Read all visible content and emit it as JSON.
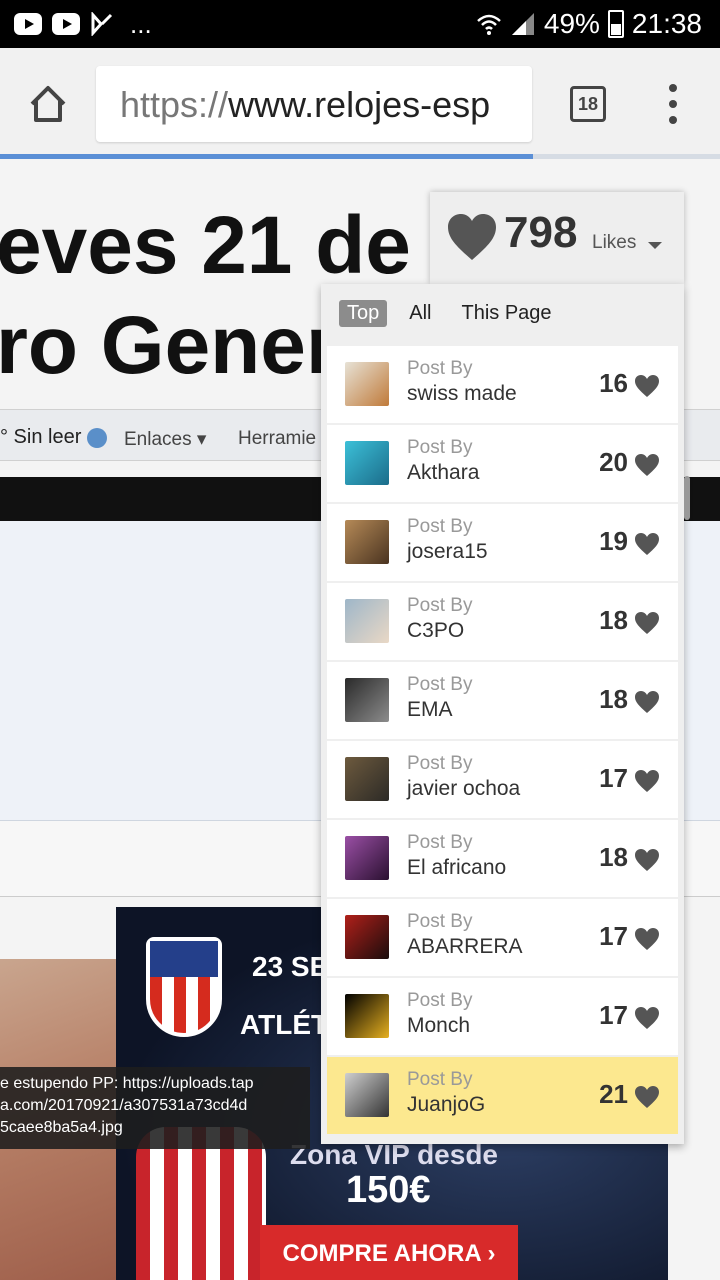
{
  "status_bar": {
    "battery": "49%",
    "time": "21:38",
    "more": "..."
  },
  "browser": {
    "url_scheme": "https://",
    "url_rest": "www.relojes-esp",
    "tab_count": "18",
    "load_progress": 0.74
  },
  "page": {
    "headline_line1": "eves 21 de",
    "headline_line2": "ro Gener",
    "nav_unread": "° Sin leer",
    "nav_links": "Enlaces",
    "nav_tools": "Herramie",
    "tooltip": "e estupendo PP: https://uploads.tap\na.com/20170921/a307531a73cd4d\n5caee8ba5a4.jpg",
    "ad": {
      "date": "23 SE",
      "team": "ATLÉT",
      "zona": "Zona VIP desde",
      "price": "150€",
      "cta": "COMPRE AHORA ›"
    }
  },
  "likes": {
    "count": "798",
    "label": "Likes",
    "filters": [
      "Top",
      "All",
      "This Page"
    ],
    "active_filter": "Top",
    "post_by_label": "Post By",
    "rows": [
      {
        "user": "swiss made",
        "count": "16",
        "highlight": false,
        "avatar_colors": [
          "#e7e2d6",
          "#c07a3a"
        ]
      },
      {
        "user": "Akthara",
        "count": "20",
        "highlight": false,
        "avatar_colors": [
          "#3cc0d8",
          "#1b6c8a"
        ]
      },
      {
        "user": "josera15",
        "count": "19",
        "highlight": false,
        "avatar_colors": [
          "#b58a57",
          "#4a3320"
        ]
      },
      {
        "user": "C3PO",
        "count": "18",
        "highlight": false,
        "avatar_colors": [
          "#9eb6c8",
          "#e9d8c6"
        ]
      },
      {
        "user": "EMA",
        "count": "18",
        "highlight": false,
        "avatar_colors": [
          "#2a2a2a",
          "#8c8c8c"
        ]
      },
      {
        "user": "javier ochoa",
        "count": "17",
        "highlight": false,
        "avatar_colors": [
          "#6d5a3e",
          "#2c2a26"
        ]
      },
      {
        "user": "El africano",
        "count": "18",
        "highlight": false,
        "avatar_colors": [
          "#9a4fa5",
          "#2a1030"
        ]
      },
      {
        "user": "ABARRERA",
        "count": "17",
        "highlight": false,
        "avatar_colors": [
          "#b0201a",
          "#1a0c0c"
        ]
      },
      {
        "user": "Monch",
        "count": "17",
        "highlight": false,
        "avatar_colors": [
          "#000000",
          "#e6b020"
        ]
      },
      {
        "user": "JuanjoG",
        "count": "21",
        "highlight": true,
        "avatar_colors": [
          "#cfcfcf",
          "#333333"
        ]
      }
    ]
  },
  "colors": {
    "highlight_row": "#fce88f",
    "heart": "#555555",
    "progress": "#5b8fd6"
  }
}
